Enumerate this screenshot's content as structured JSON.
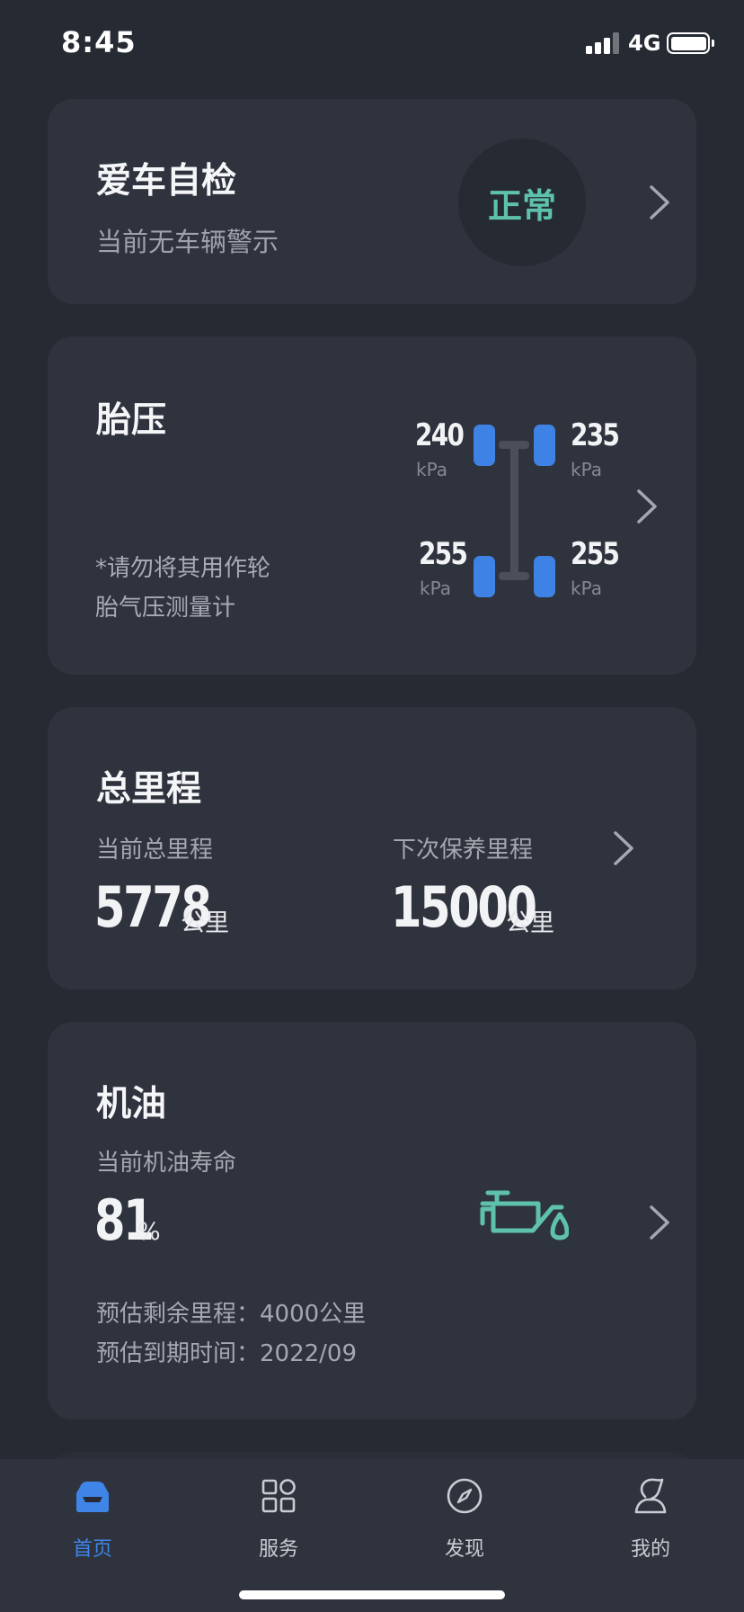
{
  "status_bar": {
    "time": "8:45",
    "network": "4G"
  },
  "self_check": {
    "title": "爱车自检",
    "subtitle": "当前无车辆警示",
    "status": "正常"
  },
  "tire_pressure": {
    "title": "胎压",
    "note_line1": "*请勿将其用作轮",
    "note_line2": "胎气压测量计",
    "unit": "kPa",
    "front_left": "240",
    "front_right": "235",
    "rear_left": "255",
    "rear_right": "255"
  },
  "mileage": {
    "title": "总里程",
    "current_label": "当前总里程",
    "current_value": "5778",
    "next_label": "下次保养里程",
    "next_value": "15000",
    "unit": "公里"
  },
  "oil": {
    "title": "机油",
    "life_label": "当前机油寿命",
    "life_value": "81",
    "life_unit": "%",
    "remaining": "预估剩余里程：4000公里",
    "expiry": "预估到期时间：2022/09"
  },
  "tabs": [
    {
      "label": "首页",
      "icon": "car-home-icon"
    },
    {
      "label": "服务",
      "icon": "grid-icon"
    },
    {
      "label": "发现",
      "icon": "compass-icon"
    },
    {
      "label": "我的",
      "icon": "user-icon"
    }
  ],
  "colors": {
    "accent_teal": "#5ec1ac",
    "accent_blue": "#3f85e8",
    "card_bg": "#2f333e",
    "page_bg": "#262a33"
  }
}
